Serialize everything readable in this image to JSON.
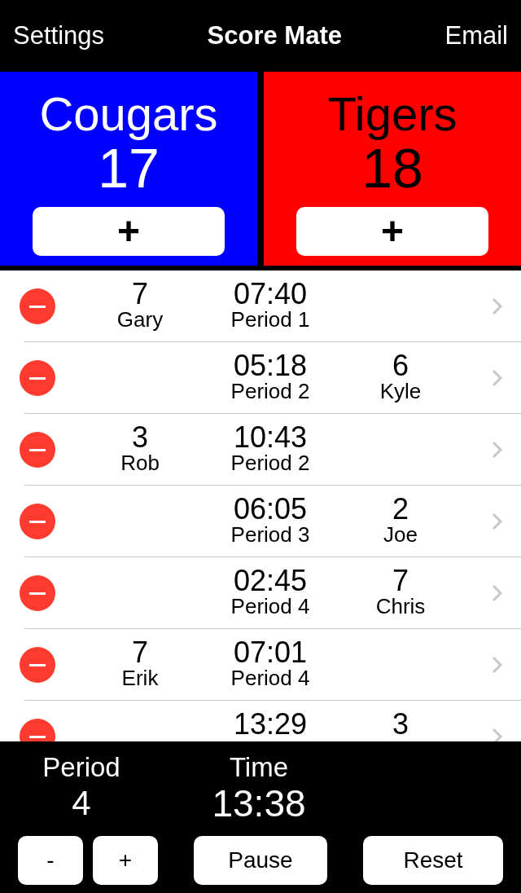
{
  "nav": {
    "left": "Settings",
    "title": "Score Mate",
    "right": "Email"
  },
  "teams": [
    {
      "name": "Cougars",
      "score": "17",
      "color": "#0000ff",
      "kind": "light",
      "add": "+"
    },
    {
      "name": "Tigers",
      "score": "18",
      "color": "#ff0000",
      "kind": "dark",
      "add": "+"
    }
  ],
  "events": [
    {
      "home": {
        "points": "7",
        "player": "Gary"
      },
      "time": "07:40",
      "period": "Period 1"
    },
    {
      "away": {
        "points": "6",
        "player": "Kyle"
      },
      "time": "05:18",
      "period": "Period 2"
    },
    {
      "home": {
        "points": "3",
        "player": "Rob"
      },
      "time": "10:43",
      "period": "Period 2"
    },
    {
      "away": {
        "points": "2",
        "player": "Joe"
      },
      "time": "06:05",
      "period": "Period 3"
    },
    {
      "away": {
        "points": "7",
        "player": "Chris"
      },
      "time": "02:45",
      "period": "Period 4"
    },
    {
      "home": {
        "points": "7",
        "player": "Erik"
      },
      "time": "07:01",
      "period": "Period 4"
    },
    {
      "away": {
        "points": "3"
      },
      "time": "13:29"
    }
  ],
  "clock": {
    "period_label": "Period",
    "period": "4",
    "time_label": "Time",
    "time": "13:38"
  },
  "buttons": [
    {
      "kind": "decrement",
      "label": "-"
    },
    {
      "kind": "increment",
      "label": "+"
    },
    {
      "kind": "pause",
      "label": "Pause"
    },
    {
      "kind": "reset",
      "label": "Reset"
    }
  ]
}
